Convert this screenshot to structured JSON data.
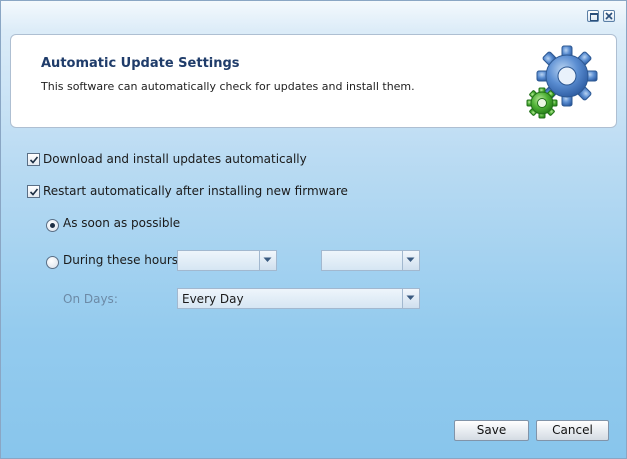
{
  "header": {
    "title": "Automatic Update Settings",
    "description": "This software can automatically check for updates and install them."
  },
  "options": {
    "auto_install": {
      "label": "Download and install updates automatically",
      "checked": true
    },
    "auto_restart": {
      "label": "Restart automatically after installing new firmware",
      "checked": true
    },
    "asap": {
      "label": "As soon as possible",
      "selected": true
    },
    "hours": {
      "label": "During these hours",
      "selected": false,
      "start_value": "",
      "end_value": ""
    },
    "days": {
      "label": "On Days:",
      "value": "Every Day"
    }
  },
  "buttons": {
    "save": "Save",
    "cancel": "Cancel"
  },
  "icons": {
    "window_maximize": "maximize-icon",
    "window_close": "close-icon",
    "header_graphic": "gears-icon",
    "dropdown": "chevron-down-icon",
    "check": "checkmark-icon"
  },
  "colors": {
    "title": "#1f3c6a",
    "gear_blue": "#4a7fc8",
    "gear_green": "#3da12a"
  }
}
